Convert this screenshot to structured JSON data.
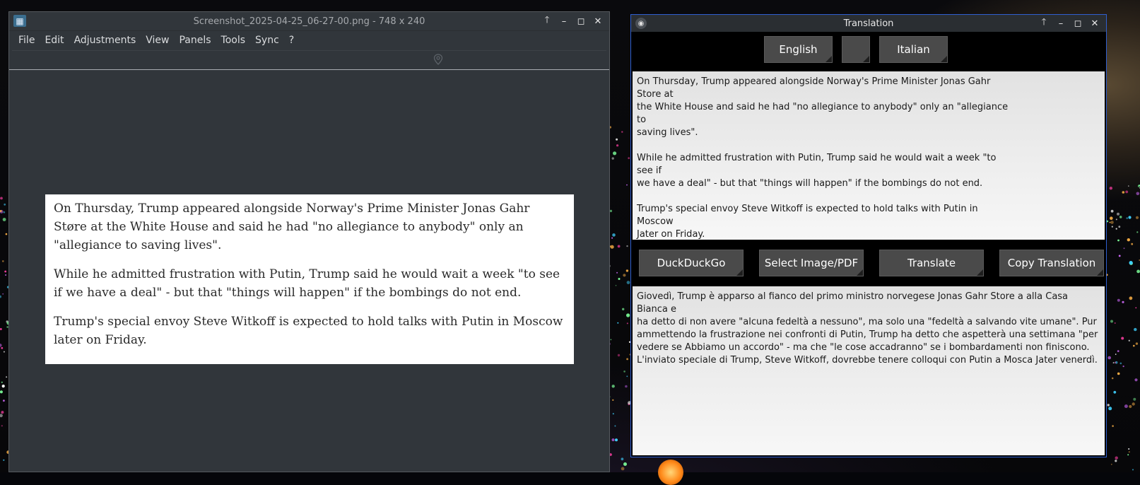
{
  "colors": {
    "accent_border": "#2f5fd0",
    "button_bg": "#4a4a4a",
    "viewer_bg": "#31363b"
  },
  "viewer": {
    "title": "Screenshot_2025-04-25_06-27-00.png  - 748 x 240",
    "menu": [
      "File",
      "Edit",
      "Adjustments",
      "View",
      "Panels",
      "Tools",
      "Sync",
      "?"
    ],
    "image_paragraphs": [
      "On Thursday, Trump appeared alongside Norway's Prime Minister Jonas Gahr Støre at the White House and said he had \"no allegiance to anybody\" only an \"allegiance to saving lives\".",
      "While he admitted frustration with Putin, Trump said he would wait a week \"to see if we have a deal\" - but that \"things will happen\" if the bombings do not end.",
      "Trump's special envoy Steve Witkoff is expected to hold talks with Putin in Moscow later on Friday."
    ]
  },
  "translator": {
    "title": "Translation",
    "source_language": "English",
    "swap_icon": "",
    "target_language": "Italian",
    "source_paragraphs": [
      "On Thursday, Trump appeared alongside Norway's Prime Minister Jonas Gahr Store at\nthe White House and said he had \"no allegiance to anybody\" only an \"allegiance to\nsaving lives\".",
      "While he admitted frustration with Putin, Trump said he would wait a week \"to see if\nwe have a deal\" - but that \"things will happen\" if the bombings do not end.",
      "Trump's special envoy Steve Witkoff is expected to hold talks with Putin in Moscow\nJater on Friday."
    ],
    "buttons": {
      "duckduckgo": "DuckDuckGo",
      "select_image": "Select Image/PDF",
      "translate": "Translate",
      "copy": "Copy Translation"
    },
    "translation_text": "Giovedì, Trump è apparso al fianco del primo ministro norvegese Jonas Gahr Store a alla Casa Bianca e\nha detto di non avere \"alcuna fedeltà a nessuno\", ma solo una \"fedeltà a salvando vite umane\". Pur\nammettendo la frustrazione nei confronti di Putin, Trump ha detto che aspetterà una settimana \"per\nvedere se Abbiamo un accordo\" - ma che \"le cose accadranno\" se i bombardamenti non finiscono.\nL'inviato speciale di Trump, Steve Witkoff, dovrebbe tenere colloqui con Putin a Mosca Jater venerdì."
  }
}
